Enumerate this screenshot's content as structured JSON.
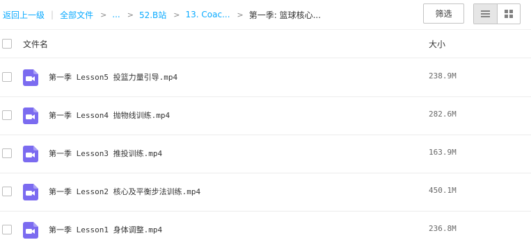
{
  "breadcrumb": {
    "back": "返回上一级",
    "separator": "|",
    "all_files": "全部文件",
    "items": [
      "...",
      "52.B站",
      "13. Coac...",
      "第一季: 篮球核心..."
    ]
  },
  "toolbar": {
    "filter_label": "筛选",
    "active_view": "list"
  },
  "table": {
    "header_name": "文件名",
    "header_size": "大小",
    "rows": [
      {
        "name": "第一季 Lesson5 投篮力量引导.mp4",
        "size": "238.9M",
        "icon": "video-file-icon"
      },
      {
        "name": "第一季 Lesson4 抛物线训练.mp4",
        "size": "282.6M",
        "icon": "video-file-icon"
      },
      {
        "name": "第一季 Lesson3 推投训练.mp4",
        "size": "163.9M",
        "icon": "video-file-icon"
      },
      {
        "name": "第一季 Lesson2 核心及平衡步法训练.mp4",
        "size": "450.1M",
        "icon": "video-file-icon"
      },
      {
        "name": "第一季 Lesson1 身体调整.mp4",
        "size": "236.8M",
        "icon": "video-file-icon"
      }
    ]
  },
  "colors": {
    "link": "#09aaff",
    "icon_purple": "#7b6bf0"
  }
}
